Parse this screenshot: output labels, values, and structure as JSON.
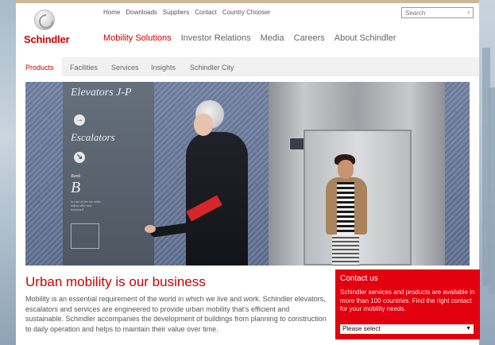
{
  "meta_nav": [
    "Home",
    "Downloads",
    "Suppliers",
    "Contact",
    "Country Chooser"
  ],
  "search": {
    "placeholder": "Search",
    "submit_icon": "chevron-right-icon"
  },
  "logo": {
    "text": "Schindler"
  },
  "main_nav": {
    "items": [
      "Mobility Solutions",
      "Investor Relations",
      "Media",
      "Careers",
      "About Schindler"
    ],
    "active": "Mobility Solutions"
  },
  "sub_nav": {
    "items": [
      "Products",
      "Facilities",
      "Services",
      "Insights",
      "Schindler City"
    ],
    "active": "Products"
  },
  "hero": {
    "panel_heading_1": "Elevators J-P",
    "panel_heading_2": "Escalators",
    "panel_bank_label": "Bank",
    "panel_bank_letter": "B",
    "panel_small_text": "in case of fire use stairs unless otherwise instructed"
  },
  "content": {
    "headline": "Urban mobility is our business",
    "body": "Mobility is an essential requirement of the world in which we live and work. Schindler elevators, escalators and services are engineered to provide urban mobility that's efficient and sustainable. Schindler accompanies the development of buildings from planning to construction to daily operation and helps to maintain their value over time."
  },
  "contact": {
    "title": "Contact us",
    "text": "Schindler services and products are available in more than 100 countries. Find the right contact for your mobility needs.",
    "select_value": "Please select"
  },
  "colors": {
    "brand_red": "#cc0000",
    "contact_bg": "#e3000f"
  }
}
